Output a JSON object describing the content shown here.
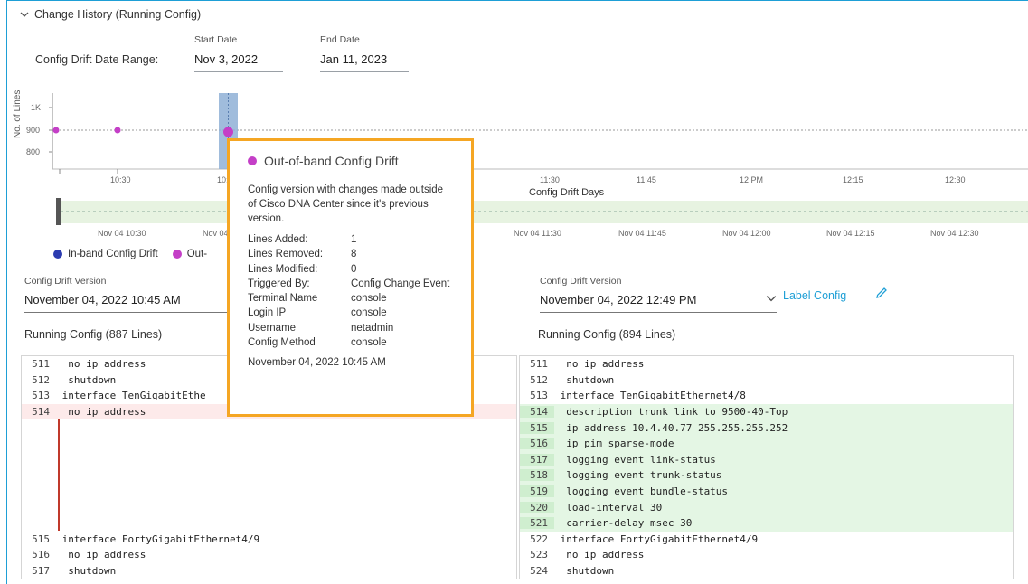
{
  "section": {
    "title": "Change History (Running Config)"
  },
  "date_range": {
    "label": "Config Drift Date Range:",
    "start_caption": "Start Date",
    "start_value": "Nov 3, 2022",
    "end_caption": "End Date",
    "end_value": "Jan 11, 2023"
  },
  "chart": {
    "y_title": "No. of Lines",
    "y_ticks": [
      "1K",
      "900",
      "800"
    ],
    "x_ticks": [
      "10:30",
      "10:",
      "11:30",
      "11:45",
      "12 PM",
      "12:15",
      "12:30"
    ],
    "x_title": "Config Drift Days",
    "range_ticks": [
      "Nov 04 10:30",
      "Nov 04",
      "Nov 04 11:30",
      "Nov 04 11:45",
      "Nov 04 12:00",
      "Nov 04 12:15",
      "Nov 04 12:30"
    ]
  },
  "chart_data": {
    "type": "scatter",
    "ylabel": "No. of Lines",
    "xlabel": "Config Drift Days",
    "series": [
      {
        "name": "Out-of-band Config Drift",
        "color": "#c43fc7",
        "points": [
          [
            "10:19",
            894
          ],
          [
            "10:30",
            894
          ],
          [
            "10:45",
            887
          ]
        ]
      }
    ]
  },
  "legend": [
    {
      "label": "In-band Config Drift",
      "color": "#2c3cb0"
    },
    {
      "label": "Out-",
      "color": "#c43fc7"
    }
  ],
  "left_version": {
    "caption": "Config Drift Version",
    "value": "November 04, 2022 10:45 AM"
  },
  "right_version": {
    "caption": "Config Drift Version",
    "value": "November 04, 2022 12:49 PM",
    "label_config": "Label Config"
  },
  "left_config": {
    "title": "Running Config (887 Lines)",
    "top": [
      {
        "n": "511",
        "t": "  no ip address"
      },
      {
        "n": "512",
        "t": "  shutdown"
      },
      {
        "n": "513",
        "t": " interface TenGigabitEthe"
      },
      {
        "n": "514",
        "t": "  no ip address",
        "removed": true
      }
    ],
    "bottom": [
      {
        "n": "515",
        "t": " interface FortyGigabitEthernet4/9"
      },
      {
        "n": "516",
        "t": "  no ip address"
      },
      {
        "n": "517",
        "t": "  shutdown"
      }
    ]
  },
  "right_config": {
    "title": "Running Config (894 Lines)",
    "lines": [
      {
        "n": "511",
        "t": "  no ip address"
      },
      {
        "n": "512",
        "t": "  shutdown"
      },
      {
        "n": "513",
        "t": " interface TenGigabitEthernet4/8"
      },
      {
        "n": "514",
        "t": "  description trunk link to 9500-40-Top",
        "added": true
      },
      {
        "n": "515",
        "t": "  ip address 10.4.40.77 255.255.255.252",
        "added": true
      },
      {
        "n": "516",
        "t": "  ip pim sparse-mode",
        "added": true
      },
      {
        "n": "517",
        "t": "  logging event link-status",
        "added": true
      },
      {
        "n": "518",
        "t": "  logging event trunk-status",
        "added": true
      },
      {
        "n": "519",
        "t": "  logging event bundle-status",
        "added": true
      },
      {
        "n": "520",
        "t": "  load-interval 30",
        "added": true
      },
      {
        "n": "521",
        "t": "  carrier-delay msec 30",
        "added": true
      },
      {
        "n": "522",
        "t": " interface FortyGigabitEthernet4/9"
      },
      {
        "n": "523",
        "t": "  no ip address"
      },
      {
        "n": "524",
        "t": "  shutdown"
      }
    ]
  },
  "tooltip": {
    "title": "Out-of-band Config Drift",
    "dot_color": "#c43fc7",
    "description": "Config version with changes made outside of Cisco DNA Center since it's previous version.",
    "rows": [
      {
        "k": "Lines Added:",
        "v": "1"
      },
      {
        "k": "Lines Removed:",
        "v": "8"
      },
      {
        "k": "Lines Modified:",
        "v": "0"
      },
      {
        "k": "Triggered By:",
        "v": "Config Change Event"
      },
      {
        "k": "Terminal Name",
        "v": "console"
      },
      {
        "k": "Login IP",
        "v": "console"
      },
      {
        "k": "Username",
        "v": "netadmin"
      },
      {
        "k": "Config Method",
        "v": "console"
      }
    ],
    "timestamp": "November 04, 2022 10:45 AM"
  }
}
